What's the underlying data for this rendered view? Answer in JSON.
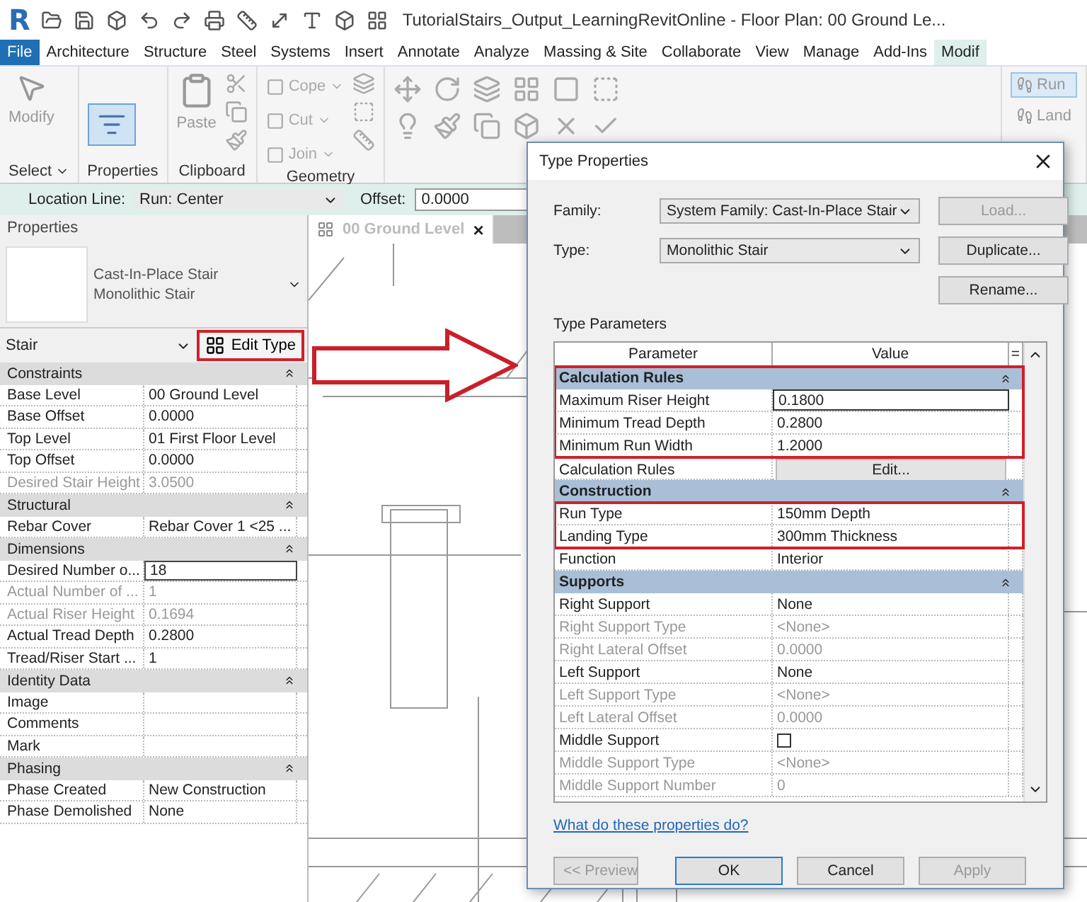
{
  "title_bar": {
    "logo": "R",
    "title": "TutorialStairs_Output_LearningRevitOnline - Floor Plan: 00 Ground Le..."
  },
  "ribbon_tabs": [
    {
      "label": "File",
      "selected": false,
      "kind": "file"
    },
    {
      "label": "Architecture",
      "selected": false,
      "kind": "tab"
    },
    {
      "label": "Structure",
      "selected": false,
      "kind": "tab"
    },
    {
      "label": "Steel",
      "selected": false,
      "kind": "tab"
    },
    {
      "label": "Systems",
      "selected": false,
      "kind": "tab"
    },
    {
      "label": "Insert",
      "selected": false,
      "kind": "tab"
    },
    {
      "label": "Annotate",
      "selected": false,
      "kind": "tab"
    },
    {
      "label": "Analyze",
      "selected": false,
      "kind": "tab"
    },
    {
      "label": "Massing & Site",
      "selected": false,
      "kind": "tab"
    },
    {
      "label": "Collaborate",
      "selected": false,
      "kind": "tab"
    },
    {
      "label": "View",
      "selected": false,
      "kind": "tab"
    },
    {
      "label": "Manage",
      "selected": false,
      "kind": "tab"
    },
    {
      "label": "Add-Ins",
      "selected": false,
      "kind": "tab"
    },
    {
      "label": "Modif",
      "selected": true,
      "kind": "tab"
    }
  ],
  "ribbon_panels": [
    {
      "label": "Select",
      "dropdown": true,
      "kind": "select",
      "tool": "Modify"
    },
    {
      "label": "Properties",
      "dropdown": false,
      "kind": "properties"
    },
    {
      "label": "Clipboard",
      "dropdown": false,
      "kind": "clipboard",
      "tool": "Paste"
    },
    {
      "label": "Geometry",
      "dropdown": false,
      "kind": "geometry",
      "tools": [
        "Cope",
        "Cut",
        "Join"
      ]
    },
    {
      "kind": "modify_tools"
    },
    {
      "kind": "run_tools",
      "tools": [
        "Run",
        "Land"
      ]
    }
  ],
  "options_bar": {
    "location_label": "Location Line:",
    "location_value": "Run: Center",
    "offset_label": "Offset:",
    "offset_value": "0.0000"
  },
  "properties": {
    "title": "Properties",
    "family": "Cast-In-Place Stair",
    "type": "Monolithic Stair",
    "category": "Stair",
    "edit_type": "Edit Type",
    "edit_type_highlighted": true,
    "sections": [
      {
        "title": "Constraints",
        "expanded": true,
        "rows": [
          {
            "name": "Base Level",
            "value": "00 Ground Level",
            "disabled": false,
            "editing": false
          },
          {
            "name": "Base Offset",
            "value": "0.0000",
            "disabled": false,
            "editing": false
          },
          {
            "name": "Top Level",
            "value": "01 First Floor Level",
            "disabled": false,
            "editing": false
          },
          {
            "name": "Top Offset",
            "value": "0.0000",
            "disabled": false,
            "editing": false
          },
          {
            "name": "Desired Stair Height",
            "value": "3.0500",
            "disabled": true,
            "editing": false
          }
        ]
      },
      {
        "title": "Structural",
        "expanded": true,
        "rows": [
          {
            "name": "Rebar Cover",
            "value": "Rebar Cover 1 <25 ...",
            "disabled": false,
            "editing": false
          }
        ]
      },
      {
        "title": "Dimensions",
        "expanded": true,
        "rows": [
          {
            "name": "Desired Number o...",
            "value": "18",
            "disabled": false,
            "editing": true
          },
          {
            "name": "Actual Number of ...",
            "value": "1",
            "disabled": true,
            "editing": false
          },
          {
            "name": "Actual Riser Height",
            "value": "0.1694",
            "disabled": true,
            "editing": false
          },
          {
            "name": "Actual Tread Depth",
            "value": "0.2800",
            "disabled": false,
            "editing": false
          },
          {
            "name": "Tread/Riser Start ...",
            "value": "1",
            "disabled": false,
            "editing": false
          }
        ]
      },
      {
        "title": "Identity Data",
        "expanded": true,
        "rows": [
          {
            "name": "Image",
            "disabled": false,
            "editing": false
          },
          {
            "name": "Comments",
            "disabled": false,
            "editing": false
          },
          {
            "name": "Mark",
            "disabled": false,
            "editing": false
          }
        ]
      },
      {
        "title": "Phasing",
        "expanded": true,
        "rows": [
          {
            "name": "Phase Created",
            "value": "New Construction",
            "disabled": false,
            "editing": false
          },
          {
            "name": "Phase Demolished",
            "value": "None",
            "disabled": false,
            "editing": false
          }
        ]
      }
    ]
  },
  "view_tab": {
    "label": "00 Ground Level",
    "close": "×"
  },
  "dialog": {
    "title": "Type Properties",
    "family_label": "Family:",
    "family_value": "System Family: Cast-In-Place Stair",
    "type_label": "Type:",
    "type_value": "Monolithic Stair",
    "side_buttons": [
      {
        "label": "Load...",
        "disabled": true
      },
      {
        "label": "Duplicate...",
        "disabled": false
      },
      {
        "label": "Rename...",
        "disabled": false
      }
    ],
    "parameters_label": "Type Parameters",
    "columns": [
      "Parameter",
      "Value",
      "="
    ],
    "items": [
      {
        "kind": "highlight_box",
        "items": [
          {
            "kind": "header",
            "name": "Calculation Rules",
            "expanded": true
          },
          {
            "kind": "param",
            "name": "Maximum Riser Height",
            "value": "0.1800",
            "disabled": false,
            "editing": true
          },
          {
            "kind": "param",
            "name": "Minimum Tread Depth",
            "value": "0.2800",
            "disabled": false,
            "editing": false
          },
          {
            "kind": "param",
            "name": "Minimum Run Width",
            "value": "1.2000",
            "disabled": false,
            "editing": false
          }
        ]
      },
      {
        "kind": "button",
        "name": "Calculation Rules",
        "value": "Edit...",
        "disabled": false
      },
      {
        "kind": "header",
        "name": "Construction",
        "expanded": true
      },
      {
        "kind": "highlight_box",
        "items": [
          {
            "kind": "param",
            "name": "Run Type",
            "value": "150mm Depth",
            "disabled": false,
            "editing": false
          },
          {
            "kind": "param",
            "name": "Landing Type",
            "value": "300mm Thickness",
            "disabled": false,
            "editing": false
          }
        ]
      },
      {
        "kind": "param",
        "name": "Function",
        "value": "Interior",
        "disabled": false,
        "editing": false
      },
      {
        "kind": "header",
        "name": "Supports",
        "expanded": true
      },
      {
        "kind": "param",
        "name": "Right Support",
        "value": "None",
        "disabled": false,
        "editing": false
      },
      {
        "kind": "param",
        "name": "Right Support Type",
        "value": "<None>",
        "disabled": true,
        "editing": false
      },
      {
        "kind": "param",
        "name": "Right Lateral Offset",
        "value": "0.0000",
        "disabled": true,
        "editing": false
      },
      {
        "kind": "param",
        "name": "Left Support",
        "value": "None",
        "disabled": false,
        "editing": false
      },
      {
        "kind": "param",
        "name": "Left Support Type",
        "value": "<None>",
        "disabled": true,
        "editing": false
      },
      {
        "kind": "param",
        "name": "Left Lateral Offset",
        "value": "0.0000",
        "disabled": true,
        "editing": false
      },
      {
        "kind": "checkbox",
        "name": "Middle Support",
        "checked": false,
        "disabled": false
      },
      {
        "kind": "param",
        "name": "Middle Support Type",
        "value": "<None>",
        "disabled": true,
        "editing": false
      },
      {
        "kind": "param",
        "name": "Middle Support Number",
        "value": "0",
        "disabled": true,
        "editing": false
      }
    ],
    "help_link": "What do these properties do?",
    "footer_buttons": [
      {
        "label": "<< Preview",
        "disabled": true,
        "default": false
      },
      {
        "label": "OK",
        "disabled": false,
        "default": true
      },
      {
        "label": "Cancel",
        "disabled": false,
        "default": false
      },
      {
        "label": "Apply",
        "disabled": true,
        "default": false
      }
    ]
  }
}
